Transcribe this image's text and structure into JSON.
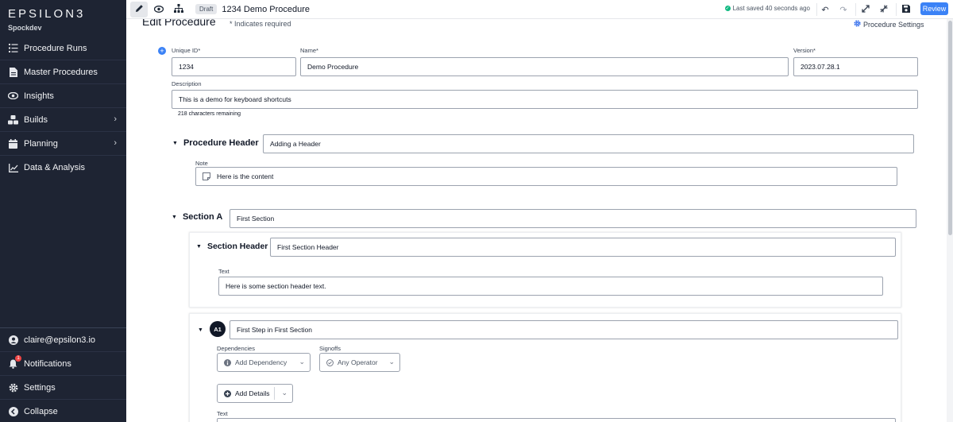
{
  "sidebar": {
    "logo": "EPSILON3",
    "workspace": "Spockdev",
    "items": [
      {
        "label": "Procedure Runs",
        "icon": "list-icon"
      },
      {
        "label": "Master Procedures",
        "icon": "document-icon"
      },
      {
        "label": "Insights",
        "icon": "eye-icon"
      },
      {
        "label": "Builds",
        "icon": "cubes-icon",
        "chevron": true
      },
      {
        "label": "Planning",
        "icon": "calendar-icon",
        "chevron": true
      },
      {
        "label": "Data & Analysis",
        "icon": "chart-line-icon"
      }
    ],
    "bottom": [
      {
        "label": "claire@epsilon3.io",
        "icon": "user-icon"
      },
      {
        "label": "Notifications",
        "icon": "bell-icon",
        "badge": "1"
      },
      {
        "label": "Settings",
        "icon": "gear-icon"
      },
      {
        "label": "Collapse",
        "icon": "collapse-icon"
      }
    ]
  },
  "topbar": {
    "draft": "Draft",
    "title": "1234 Demo Procedure",
    "saved": "Last saved 40 seconds ago",
    "review": "Review"
  },
  "main": {
    "title": "Edit Procedure",
    "required_note": "* Indicates required",
    "settings": "Procedure Settings",
    "unique_id_label": "Unique ID*",
    "unique_id": "1234",
    "name_label": "Name*",
    "name": "Demo Procedure",
    "version_label": "Version*",
    "version": "2023.07.28.1",
    "description_label": "Description",
    "description": "This is a demo for keyboard shortcuts",
    "chars_remaining": "218 characters remaining",
    "proc_header_title": "Procedure Header",
    "proc_header_value": "Adding a Header",
    "note_label": "Note",
    "note_value": "Here is the content",
    "section_title": "Section A",
    "section_value": "First Section",
    "section_header_title": "Section Header",
    "section_header_value": "First Section Header",
    "text_label": "Text",
    "section_header_text": "Here is some section header text.",
    "step_badge": "A1",
    "step_value": "First Step in First Section",
    "dependencies_label": "Dependencies",
    "dependencies_btn": "Add Dependency",
    "signoffs_label": "Signoffs",
    "signoffs_btn": "Any Operator",
    "add_details": "Add Details",
    "step_text_label": "Text"
  }
}
